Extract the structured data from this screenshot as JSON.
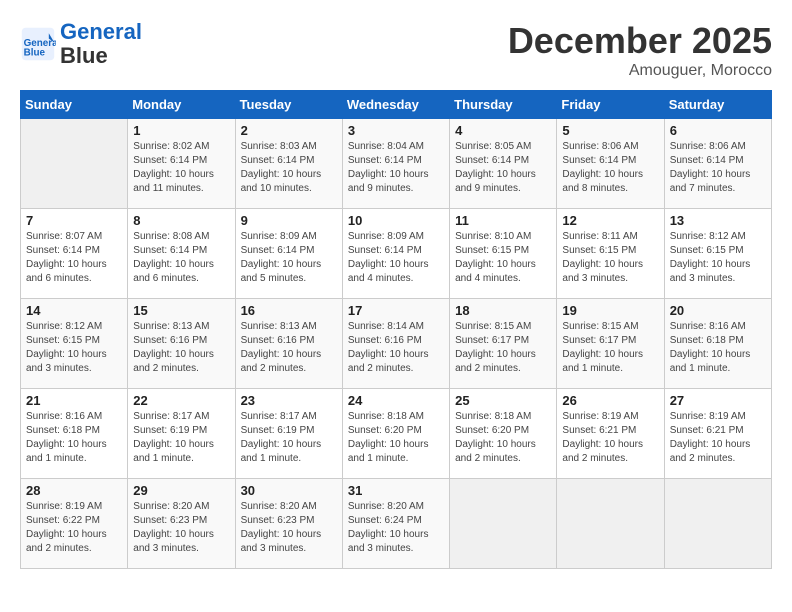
{
  "header": {
    "logo_line1": "General",
    "logo_line2": "Blue",
    "month": "December 2025",
    "location": "Amouguer, Morocco"
  },
  "weekdays": [
    "Sunday",
    "Monday",
    "Tuesday",
    "Wednesday",
    "Thursday",
    "Friday",
    "Saturday"
  ],
  "weeks": [
    [
      {
        "day": "",
        "info": ""
      },
      {
        "day": "1",
        "info": "Sunrise: 8:02 AM\nSunset: 6:14 PM\nDaylight: 10 hours\nand 11 minutes."
      },
      {
        "day": "2",
        "info": "Sunrise: 8:03 AM\nSunset: 6:14 PM\nDaylight: 10 hours\nand 10 minutes."
      },
      {
        "day": "3",
        "info": "Sunrise: 8:04 AM\nSunset: 6:14 PM\nDaylight: 10 hours\nand 9 minutes."
      },
      {
        "day": "4",
        "info": "Sunrise: 8:05 AM\nSunset: 6:14 PM\nDaylight: 10 hours\nand 9 minutes."
      },
      {
        "day": "5",
        "info": "Sunrise: 8:06 AM\nSunset: 6:14 PM\nDaylight: 10 hours\nand 8 minutes."
      },
      {
        "day": "6",
        "info": "Sunrise: 8:06 AM\nSunset: 6:14 PM\nDaylight: 10 hours\nand 7 minutes."
      }
    ],
    [
      {
        "day": "7",
        "info": "Sunrise: 8:07 AM\nSunset: 6:14 PM\nDaylight: 10 hours\nand 6 minutes."
      },
      {
        "day": "8",
        "info": "Sunrise: 8:08 AM\nSunset: 6:14 PM\nDaylight: 10 hours\nand 6 minutes."
      },
      {
        "day": "9",
        "info": "Sunrise: 8:09 AM\nSunset: 6:14 PM\nDaylight: 10 hours\nand 5 minutes."
      },
      {
        "day": "10",
        "info": "Sunrise: 8:09 AM\nSunset: 6:14 PM\nDaylight: 10 hours\nand 4 minutes."
      },
      {
        "day": "11",
        "info": "Sunrise: 8:10 AM\nSunset: 6:15 PM\nDaylight: 10 hours\nand 4 minutes."
      },
      {
        "day": "12",
        "info": "Sunrise: 8:11 AM\nSunset: 6:15 PM\nDaylight: 10 hours\nand 3 minutes."
      },
      {
        "day": "13",
        "info": "Sunrise: 8:12 AM\nSunset: 6:15 PM\nDaylight: 10 hours\nand 3 minutes."
      }
    ],
    [
      {
        "day": "14",
        "info": "Sunrise: 8:12 AM\nSunset: 6:15 PM\nDaylight: 10 hours\nand 3 minutes."
      },
      {
        "day": "15",
        "info": "Sunrise: 8:13 AM\nSunset: 6:16 PM\nDaylight: 10 hours\nand 2 minutes."
      },
      {
        "day": "16",
        "info": "Sunrise: 8:13 AM\nSunset: 6:16 PM\nDaylight: 10 hours\nand 2 minutes."
      },
      {
        "day": "17",
        "info": "Sunrise: 8:14 AM\nSunset: 6:16 PM\nDaylight: 10 hours\nand 2 minutes."
      },
      {
        "day": "18",
        "info": "Sunrise: 8:15 AM\nSunset: 6:17 PM\nDaylight: 10 hours\nand 2 minutes."
      },
      {
        "day": "19",
        "info": "Sunrise: 8:15 AM\nSunset: 6:17 PM\nDaylight: 10 hours\nand 1 minute."
      },
      {
        "day": "20",
        "info": "Sunrise: 8:16 AM\nSunset: 6:18 PM\nDaylight: 10 hours\nand 1 minute."
      }
    ],
    [
      {
        "day": "21",
        "info": "Sunrise: 8:16 AM\nSunset: 6:18 PM\nDaylight: 10 hours\nand 1 minute."
      },
      {
        "day": "22",
        "info": "Sunrise: 8:17 AM\nSunset: 6:19 PM\nDaylight: 10 hours\nand 1 minute."
      },
      {
        "day": "23",
        "info": "Sunrise: 8:17 AM\nSunset: 6:19 PM\nDaylight: 10 hours\nand 1 minute."
      },
      {
        "day": "24",
        "info": "Sunrise: 8:18 AM\nSunset: 6:20 PM\nDaylight: 10 hours\nand 1 minute."
      },
      {
        "day": "25",
        "info": "Sunrise: 8:18 AM\nSunset: 6:20 PM\nDaylight: 10 hours\nand 2 minutes."
      },
      {
        "day": "26",
        "info": "Sunrise: 8:19 AM\nSunset: 6:21 PM\nDaylight: 10 hours\nand 2 minutes."
      },
      {
        "day": "27",
        "info": "Sunrise: 8:19 AM\nSunset: 6:21 PM\nDaylight: 10 hours\nand 2 minutes."
      }
    ],
    [
      {
        "day": "28",
        "info": "Sunrise: 8:19 AM\nSunset: 6:22 PM\nDaylight: 10 hours\nand 2 minutes."
      },
      {
        "day": "29",
        "info": "Sunrise: 8:20 AM\nSunset: 6:23 PM\nDaylight: 10 hours\nand 3 minutes."
      },
      {
        "day": "30",
        "info": "Sunrise: 8:20 AM\nSunset: 6:23 PM\nDaylight: 10 hours\nand 3 minutes."
      },
      {
        "day": "31",
        "info": "Sunrise: 8:20 AM\nSunset: 6:24 PM\nDaylight: 10 hours\nand 3 minutes."
      },
      {
        "day": "",
        "info": ""
      },
      {
        "day": "",
        "info": ""
      },
      {
        "day": "",
        "info": ""
      }
    ]
  ]
}
